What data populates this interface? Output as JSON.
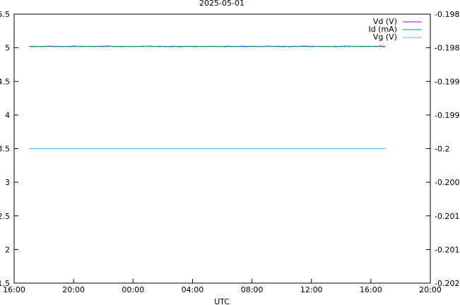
{
  "chart_data": {
    "type": "line",
    "title": "2025-05-01",
    "xlabel": "UTC",
    "ylabel": "",
    "y2label": "",
    "x_ticks": [
      "16:00",
      "20:00",
      "00:00",
      "04:00",
      "08:00",
      "12:00",
      "16:00",
      "20:00"
    ],
    "xlim": [
      "2025-05-01T16:00",
      "2025-05-02T20:00"
    ],
    "ylim": [
      1.5,
      5.5
    ],
    "y_ticks": [
      "1.5",
      "2",
      "2.5",
      "3",
      "3.5",
      "4",
      "4.5",
      "5",
      "5.5"
    ],
    "y2lim": [
      -0.202,
      -0.198
    ],
    "y2_ticks": [
      "-0.202",
      "-0.2015",
      "-0.201",
      "-0.2005",
      "-0.2",
      "-0.1995",
      "-0.199",
      "-0.1985",
      "-0.198"
    ],
    "grid": false,
    "legend_position": "top-right",
    "series": [
      {
        "name": "Vd (V)",
        "color": "#9400d3",
        "axis": "y1",
        "x": [
          "2025-05-01T17:00",
          "2025-05-02T17:00"
        ],
        "values": [
          5.02,
          5.02
        ]
      },
      {
        "name": "Id (mA)",
        "color": "#009e73",
        "axis": "y1",
        "x": [
          "2025-05-01T17:00",
          "2025-05-02T17:00"
        ],
        "values": [
          5.02,
          5.02
        ]
      },
      {
        "name": "Vg (V)",
        "color": "#56b4e9",
        "axis": "y2",
        "x": [
          "2025-05-01T17:00",
          "2025-05-02T17:00"
        ],
        "values": [
          -0.2,
          -0.2
        ]
      }
    ]
  }
}
